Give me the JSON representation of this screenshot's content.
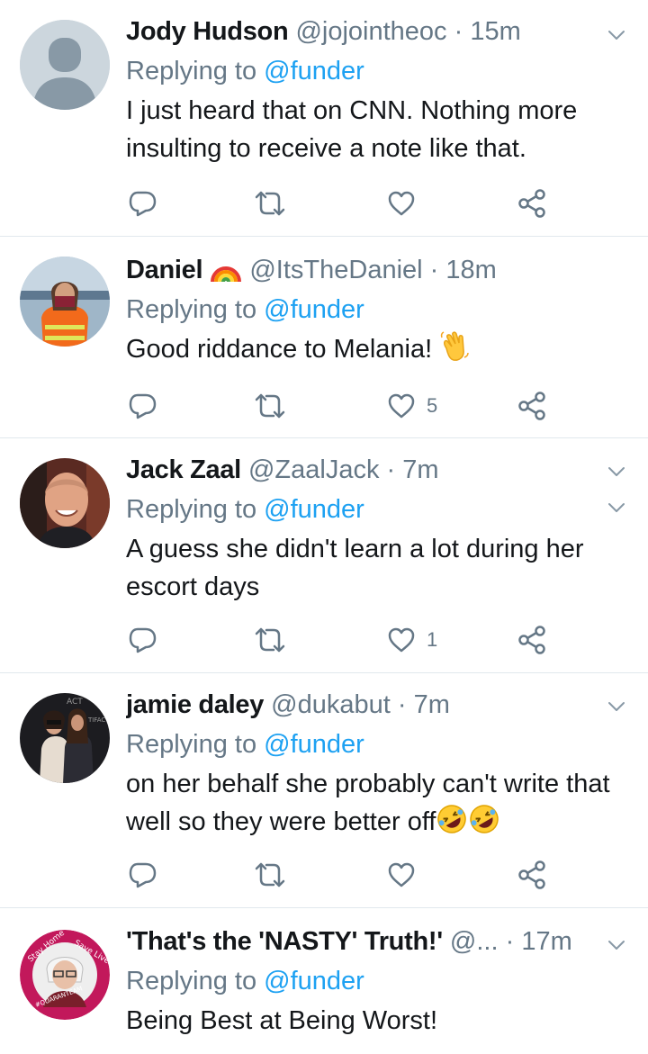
{
  "tweets": [
    {
      "name": "Jody Hudson",
      "handle": "@jojointheoc",
      "dot": "·",
      "time": "15m",
      "replying_prefix": "Replying to ",
      "replying_to": "@funder",
      "text": "I just heard that on CNN.  Nothing more insulting to receive a note like that.",
      "likes": ""
    },
    {
      "name": "Daniel",
      "handle": "@ItsTheDaniel",
      "dot": "·",
      "time": "18m",
      "replying_prefix": "Replying to ",
      "replying_to": "@funder",
      "text": "Good riddance to Melania! ",
      "likes": "5"
    },
    {
      "name": "Jack Zaal",
      "handle": "@ZaalJack",
      "dot": "·",
      "time": "7m",
      "replying_prefix": "Replying to ",
      "replying_to": "@funder",
      "text": "A guess she didn't learn a lot during her escort days",
      "likes": "1"
    },
    {
      "name": "jamie daley",
      "handle": "@dukabut",
      "dot": "·",
      "time": "7m",
      "replying_prefix": "Replying to ",
      "replying_to": "@funder",
      "text": "on her behalf she probably can't write that well so they were better off",
      "likes": ""
    },
    {
      "name": "'That's the 'NASTY' Truth!'",
      "handle": "@...",
      "dot": "·",
      "time": "17m",
      "replying_prefix": "Replying to ",
      "replying_to": "@funder",
      "text": "Being Best at Being Worst!",
      "likes": ""
    }
  ],
  "colors": {
    "text": "#14171a",
    "muted": "#657786",
    "link": "#1da1f2",
    "divider": "#e1e8ed"
  },
  "icons": {
    "reply": "reply-icon",
    "retweet": "retweet-icon",
    "like": "heart-icon",
    "share": "share-icon",
    "menu": "chevron-down-icon"
  }
}
